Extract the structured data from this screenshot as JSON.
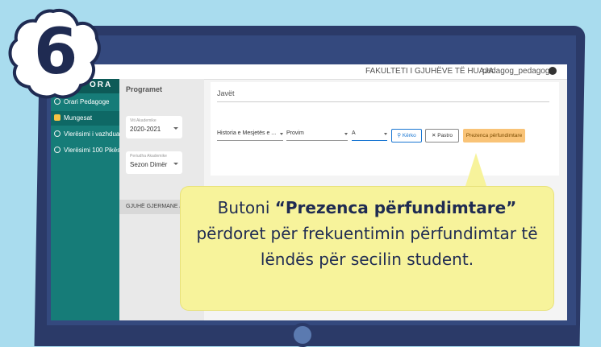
{
  "badge": {
    "number": "6"
  },
  "topbar": {
    "brand": "ORA",
    "faculty": "FAKULTETI I GJUHËVE TË HUAJA",
    "user": "pedagog_pedagog"
  },
  "sidebar": {
    "items": [
      {
        "label": "Orari Pedagoge"
      },
      {
        "label": "Mungesat"
      },
      {
        "label": "Vlerësimi i vazhduar"
      },
      {
        "label": "Vlerësimi 100 Pikësh"
      }
    ]
  },
  "left_panel": {
    "title": "Programet",
    "year_caption": "Viti Akademike",
    "year_value": "2020-2021",
    "period_caption": "Periudha Akademike",
    "period_value": "Sezon Dimër",
    "subject": "GJUHË GJERMANE / B"
  },
  "main": {
    "weeks": "Javët",
    "subject_select": "Historia e Mesjetës e ...",
    "type_select": "Provim",
    "group_select": "A",
    "search_button": "Kërko",
    "clear_button": "Pastro",
    "final_button": "Prezenca përfundimtare"
  },
  "callout": {
    "pre": "Butoni ",
    "bold": "“Prezenca përfundimtare”",
    "post": " përdoret për frekuentimin përfundimtar të lëndës për secilin student."
  },
  "colors": {
    "accent": "#f9c377",
    "sidebar": "#167c78",
    "background": "#a9dcee",
    "monitor": "#2b3a68",
    "callout": "#f7f39b"
  }
}
